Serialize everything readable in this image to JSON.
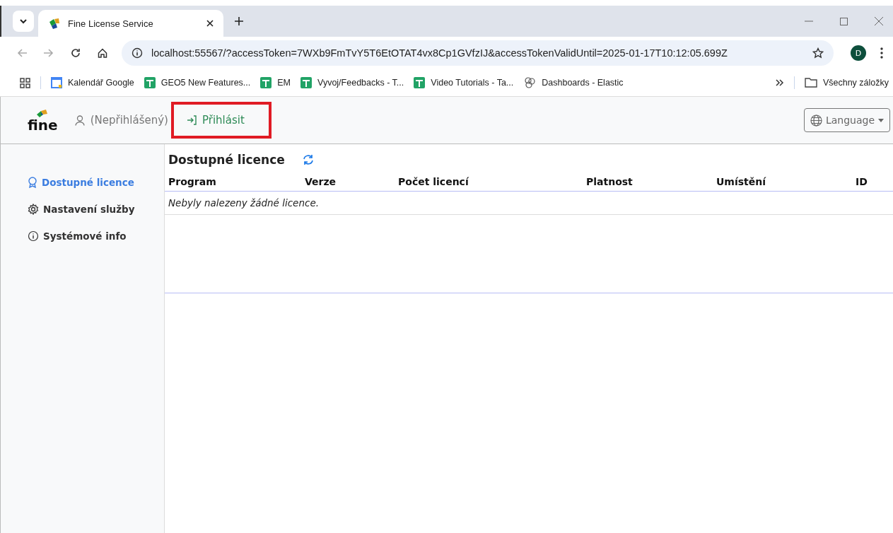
{
  "browser": {
    "tab_title": "Fine License Service",
    "url": "localhost:55567/?accessToken=7WXb9FmTvY5T6EtOTAT4vx8Cp1GVfzIJ&accessTokenValidUntil=2025-01-17T10:12:05.699Z",
    "profile_initial": "D",
    "bookmarks": [
      {
        "kind": "calendar",
        "label": "Kalendář Google"
      },
      {
        "kind": "sheet",
        "label": "GEO5 New Features..."
      },
      {
        "kind": "sheet",
        "label": "EM"
      },
      {
        "kind": "sheet",
        "label": "Vyvoj/Feedbacks - T..."
      },
      {
        "kind": "sheet",
        "label": "Video Tutorials - Ta..."
      },
      {
        "kind": "elastic",
        "label": "Dashboards - Elastic"
      }
    ],
    "all_bookmarks": "Všechny záložky"
  },
  "header": {
    "logo": "fine",
    "user": "(Nepřihlášený)",
    "login": {
      "label": "Přihlásit",
      "highlighted": true
    },
    "language": "Language"
  },
  "sidebar": {
    "items": [
      {
        "kind": "award",
        "label": "Dostupné licence",
        "selected": true
      },
      {
        "kind": "gear",
        "label": "Nastavení služby",
        "selected": false
      },
      {
        "kind": "info",
        "label": "Systémové info",
        "selected": false
      }
    ]
  },
  "main": {
    "title": "Dostupné licence",
    "table": {
      "columns": [
        "Program",
        "Verze",
        "Počet licencí",
        "Platnost",
        "Umístění",
        "ID"
      ],
      "empty_message": "Nebyly nalezeny žádné licence."
    }
  }
}
